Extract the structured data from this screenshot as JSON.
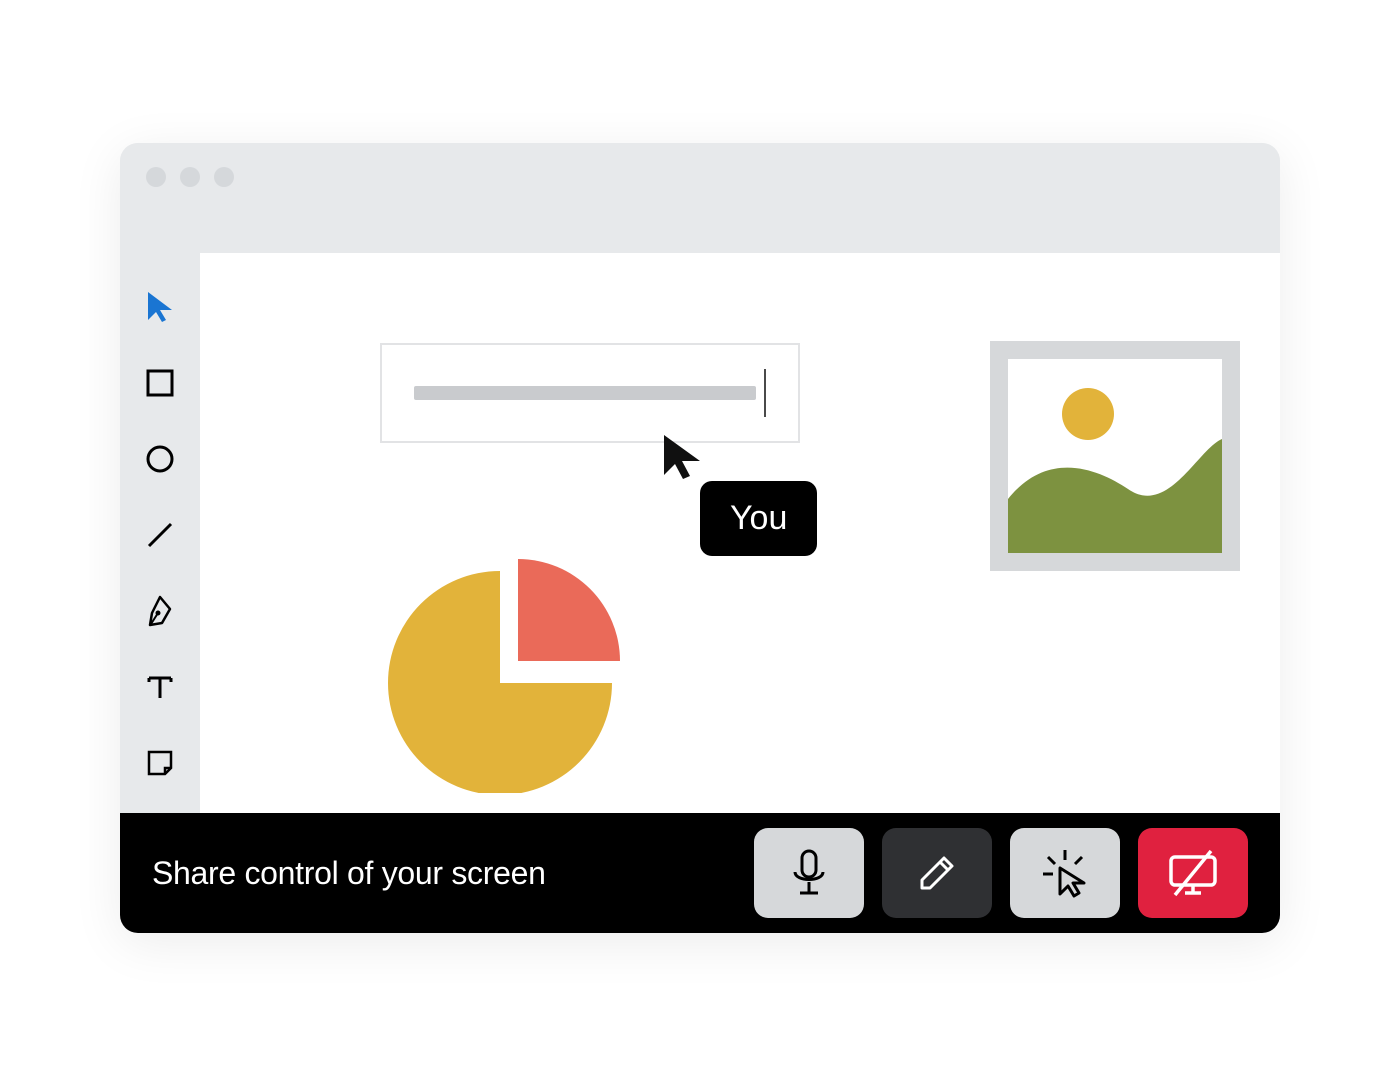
{
  "cursor": {
    "label": "You"
  },
  "controlbar": {
    "status": "Share control of your screen"
  },
  "tools": {
    "select": "select-tool",
    "rect": "rectangle-tool",
    "circle": "circle-tool",
    "line": "line-tool",
    "pen": "pen-tool",
    "text": "text-tool",
    "sticky": "sticky-note-tool"
  },
  "colors": {
    "accent_blue": "#1a75d2",
    "pie_yellow": "#e2b33a",
    "pie_red": "#ea6a59",
    "hill_green": "#7d9240",
    "danger": "#e0213f"
  }
}
